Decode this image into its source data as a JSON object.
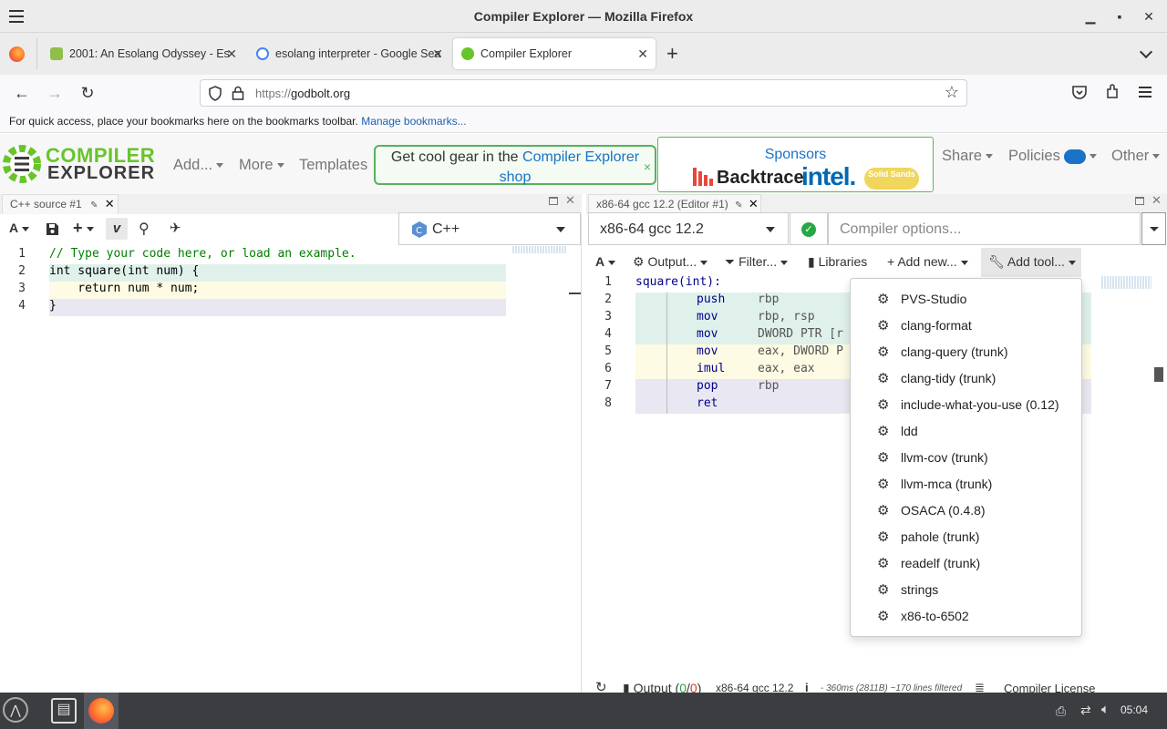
{
  "window": {
    "title": "Compiler Explorer — Mozilla Firefox",
    "minimize": "▁",
    "maximize": "▪",
    "close": "✕"
  },
  "tabs": [
    {
      "label": "2001: An Esolang Odyssey - Es"
    },
    {
      "label": "esolang interpreter - Google Sea"
    },
    {
      "label": "Compiler Explorer"
    }
  ],
  "nav": {
    "url_scheme": "https://",
    "url_host": "godbolt.org"
  },
  "bookmarks": {
    "text": "For quick access, place your bookmarks here on the bookmarks toolbar.",
    "link": "Manage bookmarks..."
  },
  "site": {
    "logo_line1": "COMPILER",
    "logo_line2": "EXPLORER",
    "menu": {
      "add": "Add...",
      "more": "More",
      "templates": "Templates",
      "share": "Share",
      "policies": "Policies",
      "other": "Other"
    },
    "gear_text": "Get cool gear in the",
    "gear_link1": "Compiler Explorer",
    "gear_link2": "shop",
    "gear_close": "×",
    "sponsors": {
      "title": "Sponsors",
      "s1": "Backtrace",
      "s2": "intel.",
      "s3": "Solid Sands"
    }
  },
  "editor": {
    "title": "C++ source #1",
    "language": "C++",
    "lines": [
      {
        "n": "1",
        "text": "// Type your code here, or load an example."
      },
      {
        "n": "2",
        "text": "int square(int num) {"
      },
      {
        "n": "3",
        "text": "    return num * num;"
      },
      {
        "n": "4",
        "text": "}"
      }
    ]
  },
  "compiler": {
    "title": "x86-64 gcc 12.2 (Editor #1)",
    "name": "x86-64 gcc 12.2",
    "options_placeholder": "Compiler options...",
    "toolbar": {
      "output": "Output...",
      "filter": "Filter...",
      "libraries": "Libraries",
      "add_new": "Add new...",
      "add_tool": "Add tool..."
    },
    "asm": [
      {
        "n": "1",
        "label": "square(int):",
        "op": "",
        "args": ""
      },
      {
        "n": "2",
        "label": "",
        "op": "push",
        "args": "rbp"
      },
      {
        "n": "3",
        "label": "",
        "op": "mov",
        "args": "rbp, rsp"
      },
      {
        "n": "4",
        "label": "",
        "op": "mov",
        "args": "DWORD PTR [r"
      },
      {
        "n": "5",
        "label": "",
        "op": "mov",
        "args": "eax, DWORD P"
      },
      {
        "n": "6",
        "label": "",
        "op": "imul",
        "args": "eax, eax"
      },
      {
        "n": "7",
        "label": "",
        "op": "pop",
        "args": "rbp"
      },
      {
        "n": "8",
        "label": "",
        "op": "ret",
        "args": ""
      }
    ],
    "status": {
      "output": "Output (",
      "zero1": "0",
      "slash": "/",
      "zero2": "0",
      ")": ")",
      "name": "x86-64 gcc 12.2",
      "info": "i",
      "timing": "- 360ms (2811B) ~170 lines filtered",
      "license": "Compiler License"
    }
  },
  "tools_menu": [
    "PVS-Studio",
    "clang-format",
    "clang-query (trunk)",
    "clang-tidy (trunk)",
    "include-what-you-use (0.12)",
    "ldd",
    "llvm-cov (trunk)",
    "llvm-mca (trunk)",
    "OSACA (0.4.8)",
    "pahole (trunk)",
    "readelf (trunk)",
    "strings",
    "x86-to-6502"
  ],
  "taskbar": {
    "time": "05:04"
  },
  "colors": {
    "accent_green": "#56b25b",
    "link_blue": "#1a73c7",
    "hl_green": "#dff1ea",
    "hl_yellow": "#fdfbe3",
    "hl_purple": "#e9e8f2"
  }
}
